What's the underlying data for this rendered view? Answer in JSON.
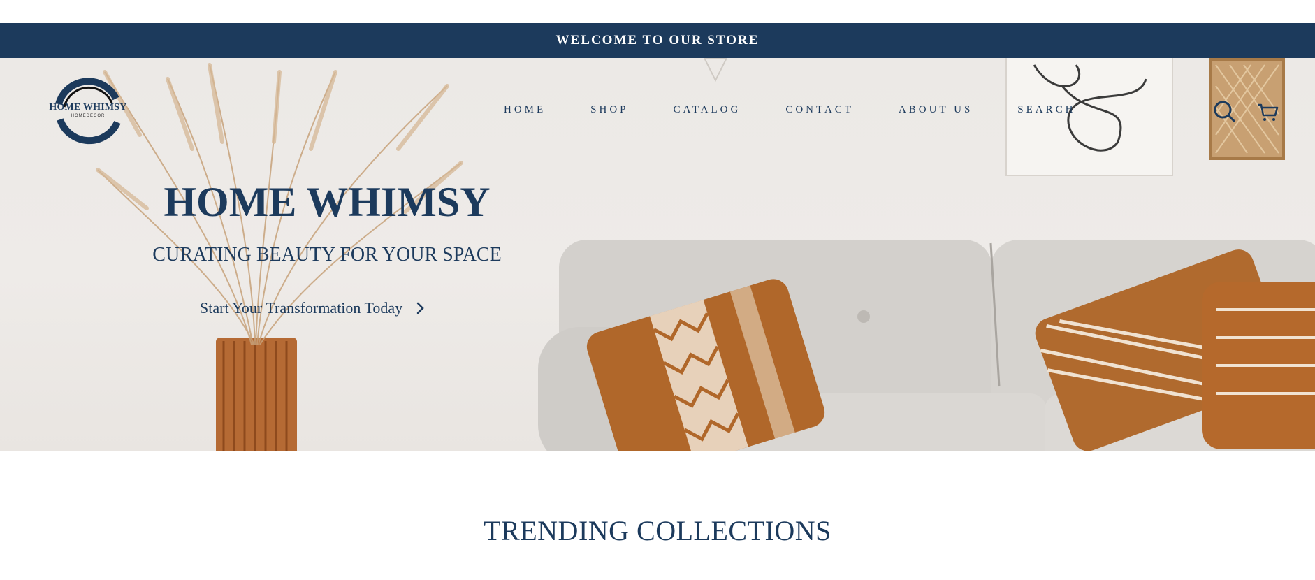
{
  "announcement": {
    "text": "WELCOME TO OUR STORE"
  },
  "brand": {
    "name": "HOME WHIMSY",
    "tagline": "HOMEDECOR"
  },
  "nav": {
    "items": [
      {
        "label": "HOME",
        "active": true
      },
      {
        "label": "SHOP"
      },
      {
        "label": "CATALOG"
      },
      {
        "label": "CONTACT"
      },
      {
        "label": "ABOUT US"
      },
      {
        "label": "SEARCH"
      }
    ]
  },
  "header_icons": [
    "search-icon",
    "cart-icon"
  ],
  "hero": {
    "title": "HOME WHIMSY",
    "subtitle": "CURATING BEAUTY FOR YOUR SPACE",
    "cta_label": "Start Your Transformation Today",
    "cta_icon": "chevron-right-icon"
  },
  "sections": {
    "trending_title": "TRENDING COLLECTIONS"
  },
  "colors": {
    "brand_navy": "#1c3a5c",
    "accent_terracotta": "#b0672a",
    "sofa_grey": "#d2cfcb"
  }
}
